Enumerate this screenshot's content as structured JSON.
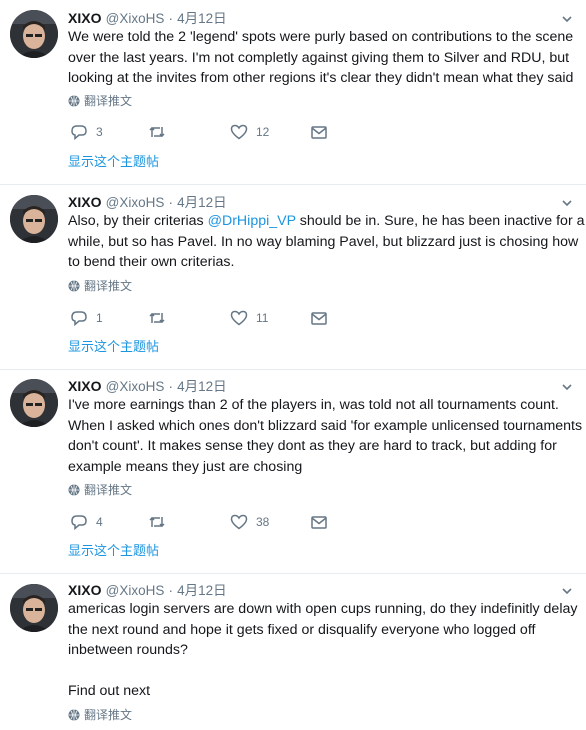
{
  "tweets": [
    {
      "name": "XIXO",
      "handle": "@XixoHS",
      "separator": "·",
      "date": "4月12日",
      "lines": [
        "We were told the 2 'legend' spots were purly based on contributions to the scene",
        "over the last years. I'm not completly against giving them to Silver and RDU, but",
        "looking at the invites from other regions it's clear they didn't mean what they said"
      ],
      "translate_label": "翻译推文",
      "replies": "3",
      "likes": "12",
      "show_thread": "显示这个主题帖"
    },
    {
      "name": "XIXO",
      "handle": "@XixoHS",
      "separator": "·",
      "date": "4月12日",
      "line1_pre": "Also, by their criterias ",
      "line1_mention": "@DrHippi_VP",
      "line1_post": " should be in. Sure, he has been inactive for a",
      "lines_rest": [
        "while, but so has Pavel. In no way blaming Pavel, but blizzard just is chosing how",
        "to bend their own criterias."
      ],
      "translate_label": "翻译推文",
      "replies": "1",
      "likes": "11",
      "show_thread": "显示这个主题帖"
    },
    {
      "name": "XIXO",
      "handle": "@XixoHS",
      "separator": "·",
      "date": "4月12日",
      "lines": [
        "I've more earnings than 2 of the players in, was told not all tournaments count.",
        "When I asked which ones don't blizzard said 'for example unlicensed tournaments",
        "don't count'. It makes sense they dont as they are hard to track, but adding for",
        "example means they just are chosing"
      ],
      "translate_label": "翻译推文",
      "replies": "4",
      "likes": "38",
      "show_thread": "显示这个主题帖"
    },
    {
      "name": "XIXO",
      "handle": "@XixoHS",
      "separator": "·",
      "date": "4月12日",
      "lines": [
        "americas login servers are down with open cups running, do they indefinitly delay",
        "the next round and hope it gets fixed or disqualify everyone who logged off",
        "inbetween rounds?"
      ],
      "extra_line": "Find out next",
      "translate_label": "翻译推文"
    }
  ],
  "colors": {
    "text": "#14171a",
    "secondary": "#657786",
    "link": "#1b95e0",
    "divider": "#e6ecf0"
  },
  "icons": [
    "avatar",
    "chevron-down-icon",
    "globe-icon",
    "reply-icon",
    "retweet-icon",
    "like-icon",
    "message-icon"
  ]
}
